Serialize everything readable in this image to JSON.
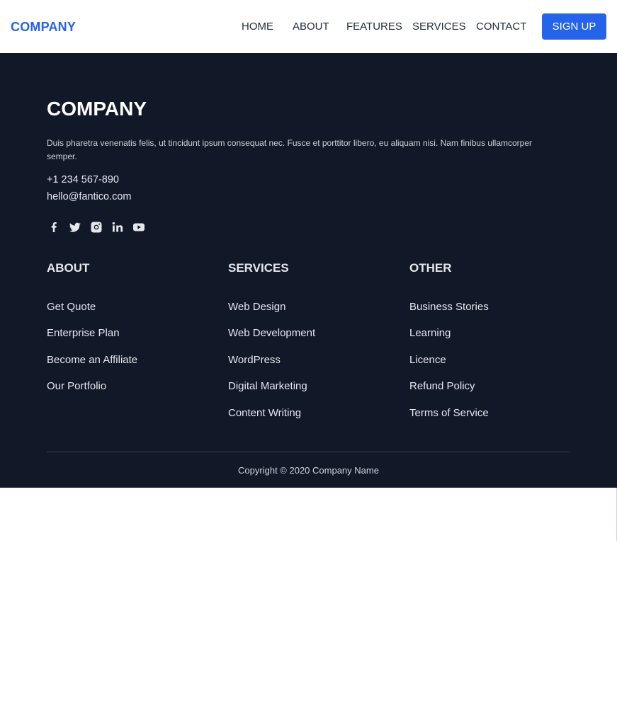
{
  "navbar": {
    "brand": "COMPANY",
    "links": [
      {
        "label": "HOME"
      },
      {
        "label": "ABOUT"
      },
      {
        "label": "FEATURES"
      },
      {
        "label": "SERVICES"
      },
      {
        "label": "CONTACT"
      }
    ],
    "signup_label": "SIGN UP"
  },
  "footer": {
    "brand": "COMPANY",
    "description": "Duis pharetra venenatis felis, ut tincidunt ipsum consequat nec. Fusce et porttitor libero, eu aliquam nisi. Nam finibus ullamcorper semper.",
    "phone": "+1 234 567-890",
    "email": "hello@fantico.com",
    "social_icons": [
      "facebook-icon",
      "twitter-icon",
      "instagram-icon",
      "linkedin-icon",
      "youtube-icon"
    ],
    "columns": [
      {
        "heading": "ABOUT",
        "links": [
          "Get Quote",
          "Enterprise Plan",
          "Become an Affiliate",
          "Our Portfolio"
        ]
      },
      {
        "heading": "SERVICES",
        "links": [
          "Web Design",
          "Web Development",
          "WordPress",
          "Digital Marketing",
          "Content Writing"
        ]
      },
      {
        "heading": "OTHER",
        "links": [
          "Business Stories",
          "Learning",
          "Licence",
          "Refund Policy",
          "Terms of Service"
        ]
      }
    ],
    "copyright": "Copyright © 2020 Company Name"
  },
  "colors": {
    "accent": "#2563eb",
    "footer_bg": "#111827",
    "footer_text": "#e5e7eb"
  }
}
